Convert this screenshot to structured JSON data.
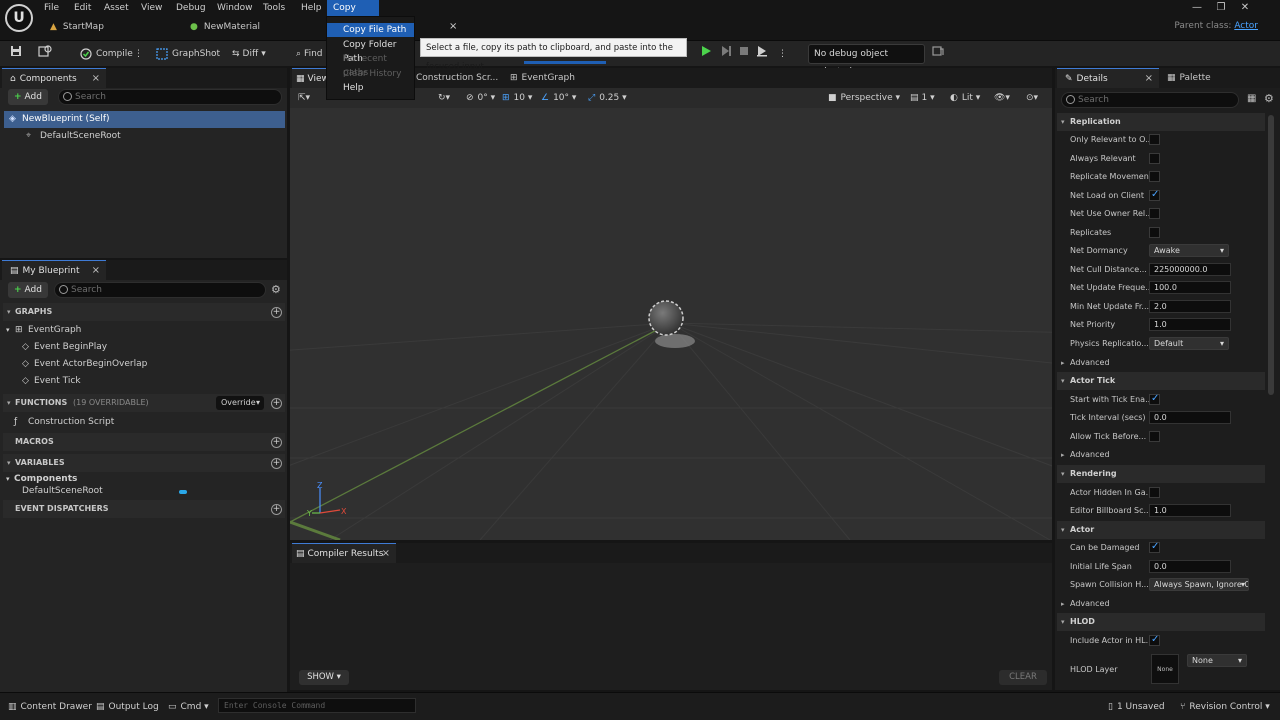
{
  "menu": {
    "logo": "U",
    "items": [
      "File",
      "Edit",
      "Asset",
      "View",
      "Debug",
      "Window",
      "Tools",
      "Help",
      "Copy Path"
    ]
  },
  "doc_tabs": [
    "StartMap",
    "NewMaterial"
  ],
  "parent_class": {
    "label": "Parent class:",
    "value": "Actor"
  },
  "dropdown": {
    "items": [
      "Copy File Path",
      "Copy Folder Path",
      "No recent paths",
      "Clear History",
      "Help"
    ],
    "close": "×",
    "tooltip": "Select a file, copy its path to clipboard, and paste into the focused input"
  },
  "toolbar": {
    "compile": "Compile",
    "graphshot": "GraphShot",
    "diff": "Diff",
    "find": "Find",
    "debug_object": "No debug object selected"
  },
  "components": {
    "tab": "Components",
    "add": "Add",
    "search_placeholder": "Search",
    "items": [
      "NewBlueprint (Self)",
      "DefaultSceneRoot"
    ]
  },
  "my_blueprint": {
    "tab": "My Blueprint",
    "add": "Add",
    "search_placeholder": "Search",
    "graphs_label": "GRAPHS",
    "event_graph": "EventGraph",
    "events": [
      "Event BeginPlay",
      "Event ActorBeginOverlap",
      "Event Tick"
    ],
    "functions_label": "FUNCTIONS",
    "functions_count": "(19 OVERRIDABLE)",
    "override": "Override",
    "construction_script": "Construction Script",
    "macros_label": "MACROS",
    "variables_label": "VARIABLES",
    "components_label": "Components",
    "default_scene_root": "DefaultSceneRoot",
    "dispatchers_label": "EVENT DISPATCHERS"
  },
  "editor_tabs": {
    "viewport": "View",
    "construction": "Construction Scr...",
    "event_graph": "EventGraph"
  },
  "viewport": {
    "rot_value": "0°",
    "grid_value": "10",
    "angle_value": "10°",
    "scale_value": "0.25",
    "perspective": "Perspective",
    "camera_count": "1",
    "lit": "Lit",
    "axis_z": "Z",
    "axis_y": "Y",
    "axis_x": "X"
  },
  "compiler": {
    "tab": "Compiler Results",
    "show": "SHOW",
    "clear": "CLEAR"
  },
  "details": {
    "tab": "Details",
    "palette": "Palette",
    "search_placeholder": "Search",
    "replication": "Replication",
    "rep_rows": [
      {
        "label": "Only Relevant to O..."
      },
      {
        "label": "Always Relevant"
      },
      {
        "label": "Replicate Movement"
      },
      {
        "label": "Net Load on Client"
      },
      {
        "label": "Net Use Owner Rel..."
      },
      {
        "label": "Replicates"
      },
      {
        "label": "Net Dormancy",
        "value": "Awake"
      },
      {
        "label": "Net Cull Distance...",
        "value": "225000000.0"
      },
      {
        "label": "Net Update Freque...",
        "value": "100.0"
      },
      {
        "label": "Min Net Update Fr...",
        "value": "2.0"
      },
      {
        "label": "Net Priority",
        "value": "1.0"
      },
      {
        "label": "Physics Replicatio...",
        "value": "Default"
      }
    ],
    "advanced": "Advanced",
    "actor_tick": "Actor Tick",
    "tick_rows": [
      {
        "label": "Start with Tick Ena..."
      },
      {
        "label": "Tick Interval (secs)",
        "value": "0.0"
      },
      {
        "label": "Allow Tick Before..."
      }
    ],
    "rendering": "Rendering",
    "render_rows": [
      {
        "label": "Actor Hidden In Ga..."
      },
      {
        "label": "Editor Billboard Sc...",
        "value": "1.0"
      }
    ],
    "actor": "Actor",
    "actor_rows": [
      {
        "label": "Can be Damaged"
      },
      {
        "label": "Initial Life Span",
        "value": "0.0"
      },
      {
        "label": "Spawn Collision H...",
        "value": "Always Spawn, Ignore C"
      }
    ],
    "hlod": "HLOD",
    "hlod_rows": [
      {
        "label": "Include Actor in HL..."
      },
      {
        "label": "HLOD Layer",
        "value": "None",
        "thumb": "None"
      }
    ]
  },
  "statusbar": {
    "content_drawer": "Content Drawer",
    "output_log": "Output Log",
    "cmd": "Cmd",
    "console_placeholder": "Enter Console Command",
    "unsaved": "1 Unsaved",
    "revision": "Revision Control"
  },
  "colors": {
    "accent": "#1f5fb4",
    "link": "#4aa3ff",
    "green": "#4cd34c"
  }
}
